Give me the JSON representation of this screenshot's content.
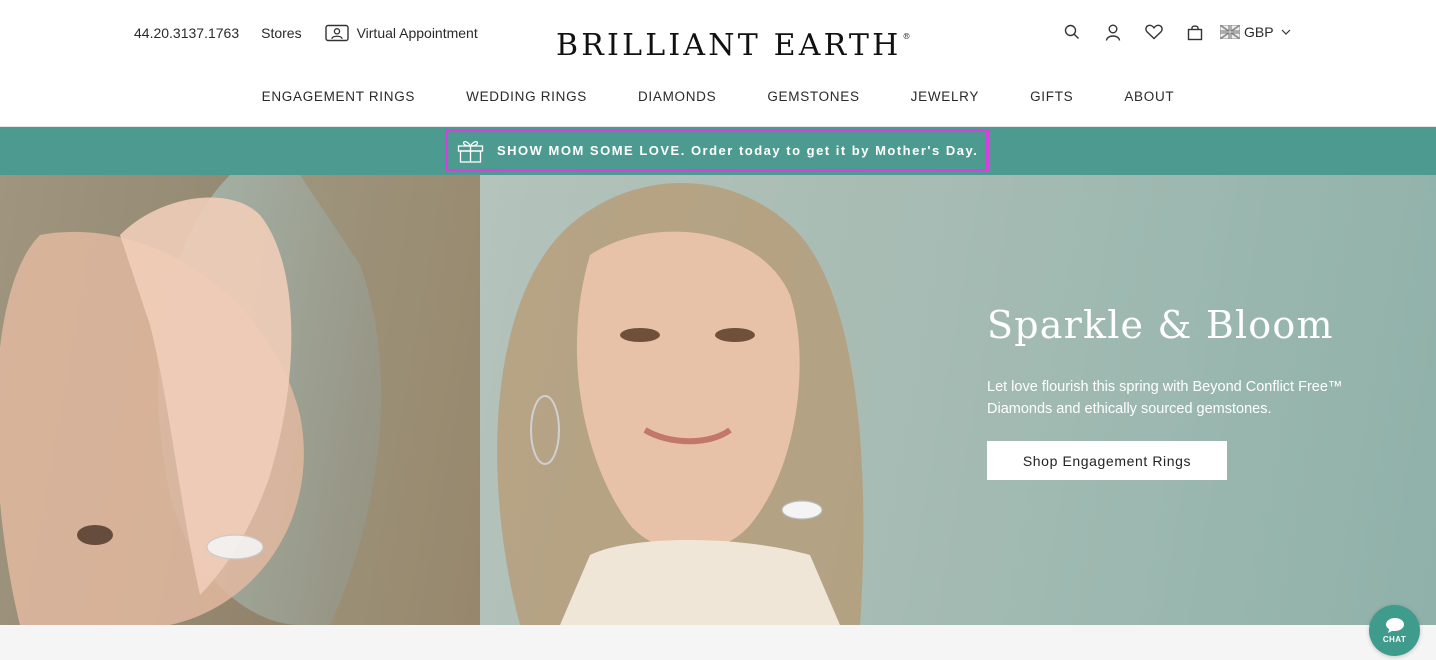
{
  "header": {
    "phone": "44.20.3137.1763",
    "stores": "Stores",
    "virtual_appointment": "Virtual Appointment",
    "logo": "BRILLIANT EARTH",
    "logo_mark": "®",
    "currency": "GBP",
    "icons": [
      "search-icon",
      "account-icon",
      "heart-icon",
      "bag-icon",
      "uk-flag-icon",
      "chevron-down-icon"
    ]
  },
  "nav": {
    "items": [
      "ENGAGEMENT RINGS",
      "WEDDING RINGS",
      "DIAMONDS",
      "GEMSTONES",
      "JEWELRY",
      "GIFTS",
      "ABOUT"
    ]
  },
  "promo": {
    "text": "SHOW MOM SOME LOVE. Order today to get it by Mother's Day.",
    "icon": "gift-icon",
    "background": "#4d9b90",
    "highlight": "#d93fe0"
  },
  "hero": {
    "title": "Sparkle & Bloom",
    "subtitle": "Let love flourish this spring with Beyond Conflict Free™ Diamonds and ethically sourced gemstones.",
    "cta": "Shop Engagement Rings"
  },
  "chat": {
    "label": "CHAT",
    "color": "#3f9b8c"
  }
}
